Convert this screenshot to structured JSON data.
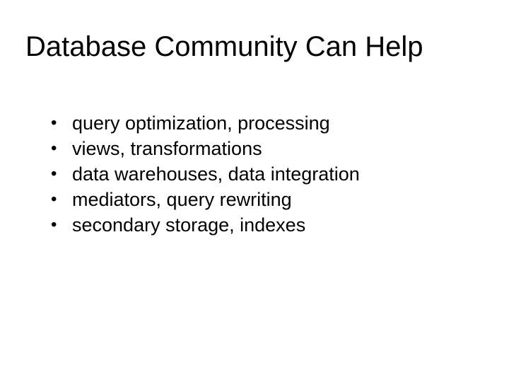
{
  "slide": {
    "title": "Database Community Can Help",
    "bullets": [
      "query optimization, processing",
      "views, transformations",
      "data warehouses, data integration",
      "mediators, query rewriting",
      "secondary storage, indexes"
    ]
  }
}
